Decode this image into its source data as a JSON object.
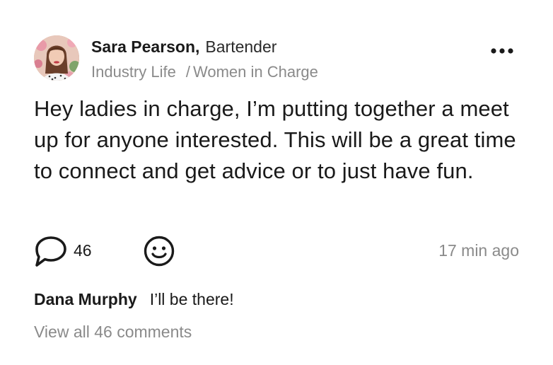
{
  "post": {
    "author": {
      "name": "Sara Pearson",
      "comma": ",",
      "role": "Bartender"
    },
    "meta": {
      "category": "Industry Life",
      "separator": "/",
      "group": "Women in Charge"
    },
    "more_icon": "more-horizontal-icon",
    "body": "Hey ladies in charge, I’m putting together a meet up for anyone interested. This will be a great time to connect and get advice or to just have fun.",
    "actions": {
      "comment_icon": "comment-bubble-icon",
      "comment_count": "46",
      "react_icon": "smiley-icon",
      "timestamp": "17 min ago"
    },
    "comment_preview": {
      "author": "Dana Murphy",
      "text": "I’ll be there!"
    },
    "view_all_label": "View all 46 comments"
  },
  "colors": {
    "text_primary": "#1a1a1a",
    "text_secondary": "#8a8a8a",
    "background": "#ffffff"
  }
}
